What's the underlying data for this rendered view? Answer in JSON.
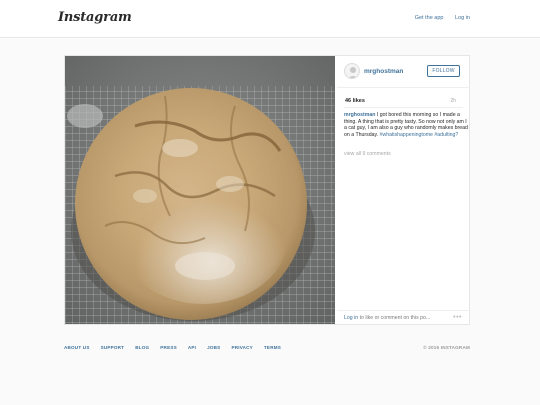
{
  "app": {
    "logo": "Instagram"
  },
  "nav": {
    "get_app": "Get the app",
    "login": "Log in"
  },
  "post": {
    "username": "mrghostman",
    "follow_label": "FOLLOW",
    "likes": "46 likes",
    "time_ago": "2h",
    "caption_user": "mrghostman",
    "caption_text": " I got bored this morning so I made a thing. A thing that is pretty tasty. So now not only am I a cat guy, I am also a guy who randomly makes bread on a Thursday. ",
    "hashtags": "#whatishappeningtome #adulting?",
    "view_all": "view all 9 comments",
    "login_link": "Log in",
    "login_prompt": " to like or comment on this po...",
    "more_label": "•••"
  },
  "footer": {
    "links": [
      "ABOUT US",
      "SUPPORT",
      "BLOG",
      "PRESS",
      "API",
      "JOBS",
      "PRIVACY",
      "TERMS"
    ],
    "copyright": "© 2015 INSTAGRAM"
  },
  "colors": {
    "link": "#3f729b",
    "muted": "#a5a7aa",
    "border": "#e6e6e6",
    "background": "#fafafa"
  }
}
